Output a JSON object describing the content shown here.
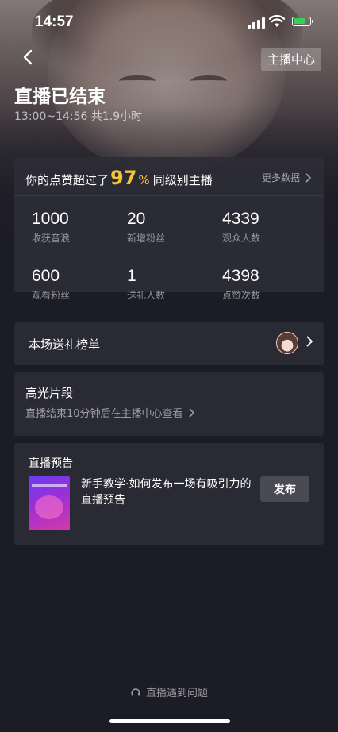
{
  "status_bar": {
    "time": "14:57"
  },
  "header": {
    "center_button": "主播中心",
    "title": "直播已结束",
    "subtitle": "13:00~14:56 共1.9小时"
  },
  "likes_summary": {
    "prefix": "你的点赞超过了",
    "percent": "97",
    "percent_sign": "%",
    "suffix": "同级别主播",
    "more_link": "更多数据"
  },
  "stats": [
    {
      "value": "1000",
      "label": "收获音浪"
    },
    {
      "value": "20",
      "label": "新增粉丝"
    },
    {
      "value": "4339",
      "label": "观众人数"
    },
    {
      "value": "600",
      "label": "观看粉丝"
    },
    {
      "value": "1",
      "label": "送礼人数"
    },
    {
      "value": "4398",
      "label": "点赞次数"
    }
  ],
  "gift_rank": {
    "label": "本场送礼榜单"
  },
  "highlights": {
    "title": "高光片段",
    "description": "直播结束10分钟后在主播中心查看"
  },
  "preview": {
    "title": "直播预告",
    "text": "新手教学·如何发布一场有吸引力的直播预告",
    "publish_button": "发布"
  },
  "help": {
    "label": "直播遇到问题"
  },
  "colors": {
    "accent": "#f5c33b",
    "background": "#1c1c26",
    "card": "#2a2a34"
  }
}
